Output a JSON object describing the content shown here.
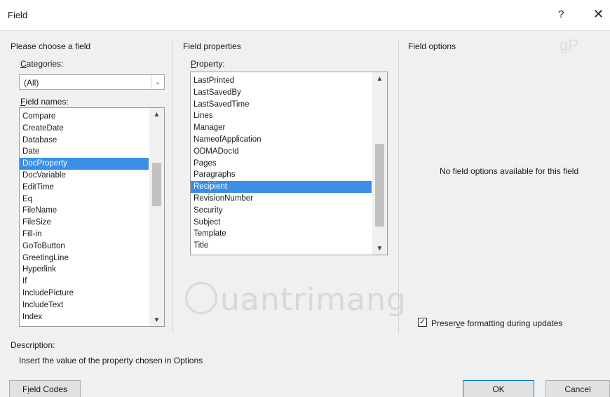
{
  "window": {
    "title": "Field",
    "help_glyph": "?",
    "close_glyph": "✕"
  },
  "choose": {
    "heading": "Please choose a field",
    "categories_label_u": "C",
    "categories_label_rest": "ategories:",
    "categories_value": "(All)",
    "field_names_label_u": "F",
    "field_names_label_rest": "ield names:",
    "field_names": [
      "Compare",
      "CreateDate",
      "Database",
      "Date",
      "DocProperty",
      "DocVariable",
      "EditTime",
      "Eq",
      "FileName",
      "FileSize",
      "Fill-in",
      "GoToButton",
      "GreetingLine",
      "Hyperlink",
      "If",
      "IncludePicture",
      "IncludeText",
      "Index"
    ],
    "selected_field": "DocProperty"
  },
  "properties": {
    "heading": "Field properties",
    "property_label_u": "P",
    "property_label_rest": "roperty:",
    "items": [
      "LastPrinted",
      "LastSavedBy",
      "LastSavedTime",
      "Lines",
      "Manager",
      "NameofApplication",
      "ODMADocId",
      "Pages",
      "Paragraphs",
      "Recipient",
      "RevisionNumber",
      "Security",
      "Subject",
      "Template",
      "Title"
    ],
    "selected": "Recipient"
  },
  "options": {
    "heading": "Field options",
    "message": "No field options available for this field",
    "preserve_pre": "Preser",
    "preserve_u": "v",
    "preserve_post": "e formatting during updates",
    "preserve_checked": true,
    "check_glyph": "✓"
  },
  "description": {
    "label": "Description:",
    "text": "Insert the value of the property chosen in Options"
  },
  "buttons": {
    "field_codes_u": "i",
    "field_codes_pre": "F",
    "field_codes_post": "eld Codes",
    "ok": "OK",
    "cancel": "Cancel"
  },
  "icons": {
    "chevron_down": "⌄",
    "scroll_up": "▲",
    "scroll_down": "▼"
  },
  "watermark": {
    "text": "uantrimang",
    "corner": "gP"
  }
}
